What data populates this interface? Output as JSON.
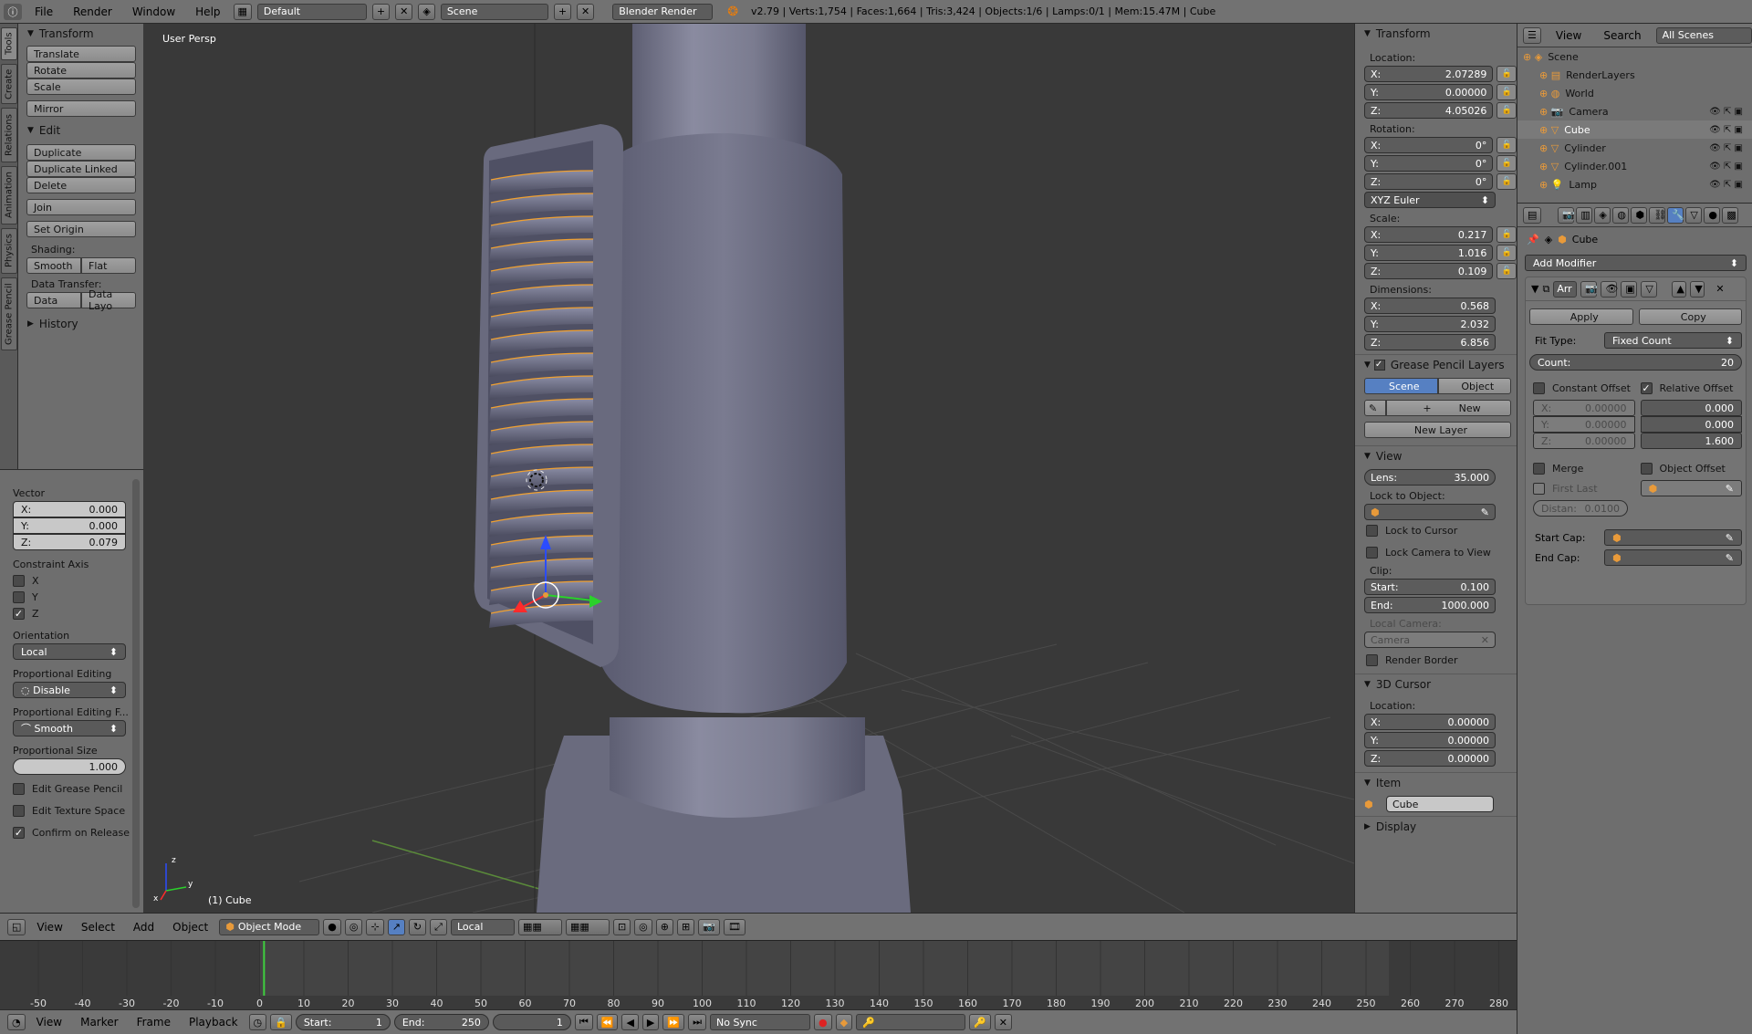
{
  "topbar": {
    "menus": [
      "File",
      "Render",
      "Window",
      "Help"
    ],
    "layout": "Default",
    "scene": "Scene",
    "engine": "Blender Render",
    "stats": "v2.79 | Verts:1,754 | Faces:1,664 | Tris:3,424 | Objects:1/6 | Lamps:0/1 | Mem:15.47M | Cube"
  },
  "tool_tabs": [
    "Tools",
    "Create",
    "Relations",
    "Animation",
    "Physics",
    "Grease Pencil"
  ],
  "toolshelf": {
    "transform_title": "Transform",
    "translate": "Translate",
    "rotate": "Rotate",
    "scale": "Scale",
    "mirror": "Mirror",
    "edit_title": "Edit",
    "duplicate": "Duplicate",
    "duplicate_linked": "Duplicate Linked",
    "delete": "Delete",
    "join": "Join",
    "set_origin": "Set Origin",
    "shading_label": "Shading:",
    "smooth": "Smooth",
    "flat": "Flat",
    "data_transfer_label": "Data Transfer:",
    "data": "Data",
    "data_layo": "Data Layo",
    "history_title": "History"
  },
  "operator": {
    "vector_label": "Vector",
    "x_label": "X:",
    "x": "0.000",
    "y_label": "Y:",
    "y": "0.000",
    "z_label": "Z:",
    "z": "0.079",
    "constraint_label": "Constraint Axis",
    "cx": "X",
    "cy": "Y",
    "cz": "Z",
    "orientation_label": "Orientation",
    "orientation": "Local",
    "prop_edit_label": "Proportional Editing",
    "prop_edit": "Disable",
    "prop_falloff_label": "Proportional Editing F...",
    "prop_falloff": "Smooth",
    "prop_size_label": "Proportional Size",
    "prop_size": "1.000",
    "edit_gp": "Edit Grease Pencil",
    "edit_tex": "Edit Texture Space",
    "confirm": "Confirm on Release"
  },
  "viewport": {
    "view_name": "User Persp",
    "object_label": "(1) Cube",
    "axis_x": "x",
    "axis_y": "y",
    "axis_z": "z"
  },
  "npanel": {
    "transform_title": "Transform",
    "location_label": "Location:",
    "loc_x": "2.07289",
    "loc_y": "0.00000",
    "loc_z": "4.05026",
    "rotation_label": "Rotation:",
    "rot_x": "0°",
    "rot_y": "0°",
    "rot_z": "0°",
    "rot_mode": "XYZ Euler",
    "scale_label": "Scale:",
    "scl_x": "0.217",
    "scl_y": "1.016",
    "scl_z": "0.109",
    "dim_label": "Dimensions:",
    "dim_x": "0.568",
    "dim_y": "2.032",
    "dim_z": "6.856",
    "gp_title": "Grease Pencil Layers",
    "gp_scene": "Scene",
    "gp_object": "Object",
    "gp_new": "New",
    "gp_new_layer": "New Layer",
    "view_title": "View",
    "lens_label": "Lens:",
    "lens": "35.000",
    "lock_obj_label": "Lock to Object:",
    "lock_cursor": "Lock to Cursor",
    "lock_cam": "Lock Camera to View",
    "clip_label": "Clip:",
    "clip_start_label": "Start:",
    "clip_start": "0.100",
    "clip_end_label": "End:",
    "clip_end": "1000.000",
    "local_cam_label": "Local Camera:",
    "local_cam": "Camera",
    "render_border": "Render Border",
    "cursor_title": "3D Cursor",
    "cursor_loc_label": "Location:",
    "cur_x": "0.00000",
    "cur_y": "0.00000",
    "cur_z": "0.00000",
    "item_title": "Item",
    "item_name": "Cube",
    "display_title": "Display",
    "x": "X:",
    "y": "Y:",
    "z": "Z:"
  },
  "outliner": {
    "view": "View",
    "search": "Search",
    "filter": "All Scenes",
    "items": [
      {
        "name": "Scene",
        "indent": 0
      },
      {
        "name": "RenderLayers",
        "indent": 1
      },
      {
        "name": "World",
        "indent": 1
      },
      {
        "name": "Camera",
        "indent": 1
      },
      {
        "name": "Cube",
        "indent": 1
      },
      {
        "name": "Cylinder",
        "indent": 1
      },
      {
        "name": "Cylinder.001",
        "indent": 1
      },
      {
        "name": "Lamp",
        "indent": 1
      }
    ]
  },
  "properties": {
    "object_name": "Cube",
    "add_modifier": "Add Modifier",
    "mod_name": "Arr",
    "apply": "Apply",
    "copy": "Copy",
    "fit_type_label": "Fit Type:",
    "fit_type": "Fixed Count",
    "count_label": "Count:",
    "count": "20",
    "const_offset": "Constant Offset",
    "rel_offset": "Relative Offset",
    "co_x": "0.00000",
    "co_y": "0.00000",
    "co_z": "0.00000",
    "ro_x": "0.000",
    "ro_y": "0.000",
    "ro_z": "1.600",
    "merge": "Merge",
    "obj_offset": "Object Offset",
    "first_last": "First Last",
    "distance_label": "Distan:",
    "distance": "0.0100",
    "start_cap": "Start Cap:",
    "end_cap": "End Cap:"
  },
  "vp_header": {
    "view": "View",
    "select": "Select",
    "add": "Add",
    "object": "Object",
    "mode": "Object Mode",
    "orientation": "Local"
  },
  "timeline": {
    "ticks": [
      "-50",
      "-40",
      "-30",
      "-20",
      "-10",
      "0",
      "10",
      "20",
      "30",
      "40",
      "50",
      "60",
      "70",
      "80",
      "90",
      "100",
      "110",
      "120",
      "130",
      "140",
      "150",
      "160",
      "170",
      "180",
      "190",
      "200",
      "210",
      "220",
      "230",
      "240",
      "250",
      "260",
      "270",
      "280"
    ],
    "current_frame": 1
  },
  "tl_header": {
    "view": "View",
    "marker": "Marker",
    "frame": "Frame",
    "playback": "Playback",
    "start_label": "Start:",
    "start": "1",
    "end_label": "End:",
    "end": "250",
    "current": "1",
    "sync": "No Sync"
  }
}
